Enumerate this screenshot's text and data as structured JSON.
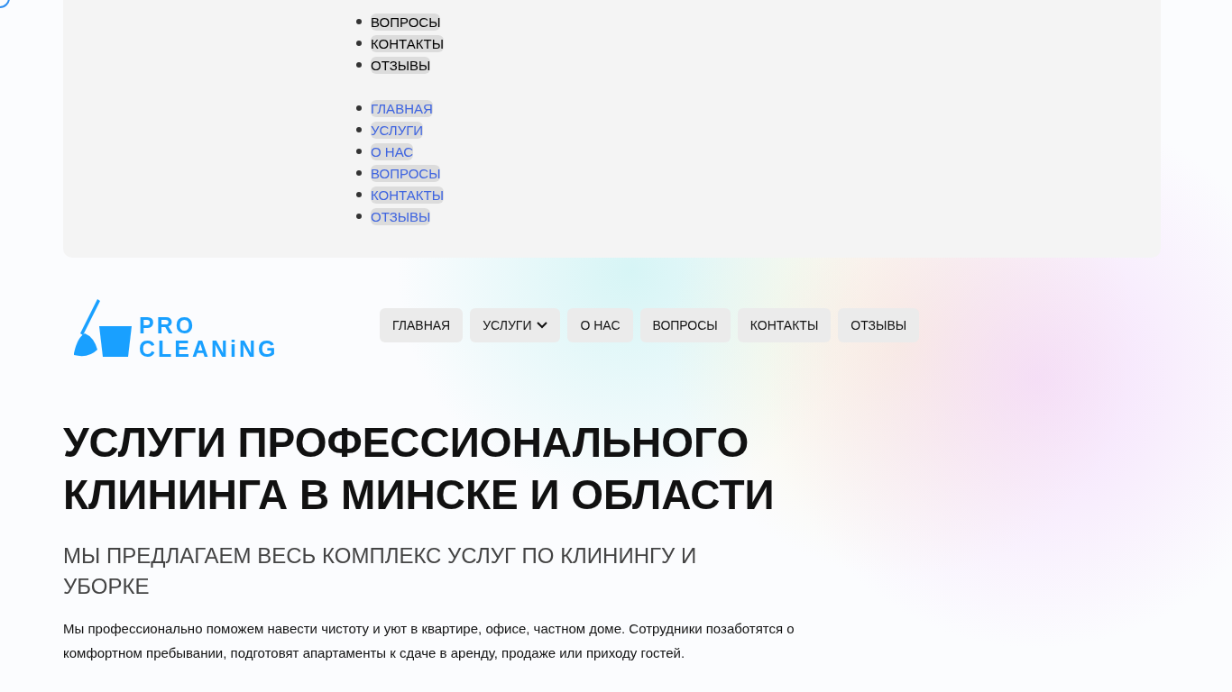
{
  "dropdown_panel": {
    "lists": [
      {
        "kind": "plain",
        "items": [
          "ВОПРОСЫ",
          "КОНТАКТЫ",
          "ОТЗЫВЫ"
        ]
      },
      {
        "kind": "link",
        "items": [
          "ГЛАВНАЯ",
          "УСЛУГИ",
          "О НАС",
          "ВОПРОСЫ",
          "КОНТАКТЫ",
          "ОТЗЫВЫ"
        ]
      }
    ]
  },
  "header": {
    "logo": {
      "line_1": "PRO",
      "line_2": "CLEANiNG"
    },
    "nav": [
      {
        "label": "ГЛАВНАЯ",
        "has_dropdown": false
      },
      {
        "label": "УСЛУГИ",
        "has_dropdown": true
      },
      {
        "label": "О НАС",
        "has_dropdown": false
      },
      {
        "label": "ВОПРОСЫ",
        "has_dropdown": false
      },
      {
        "label": "КОНТАКТЫ",
        "has_dropdown": false
      },
      {
        "label": "ОТЗЫВЫ",
        "has_dropdown": false
      }
    ]
  },
  "hero": {
    "title": "УСЛУГИ ПРОФЕССИОНАЛЬНОГО КЛИНИНГА В МИНСКЕ И ОБЛАСТИ",
    "subtitle": "МЫ ПРЕДЛАГАЕМ ВЕСЬ КОМПЛЕКС УСЛУГ ПО КЛИНИНГУ И УБОРКЕ",
    "text": "Мы профессионально поможем навести чистоту и уют в квартире, офисе, частном доме. Сотрудники позаботятся о комфортном пребывании, подготовят апартаменты к сдаче в аренду, продаже или приходу гостей."
  }
}
